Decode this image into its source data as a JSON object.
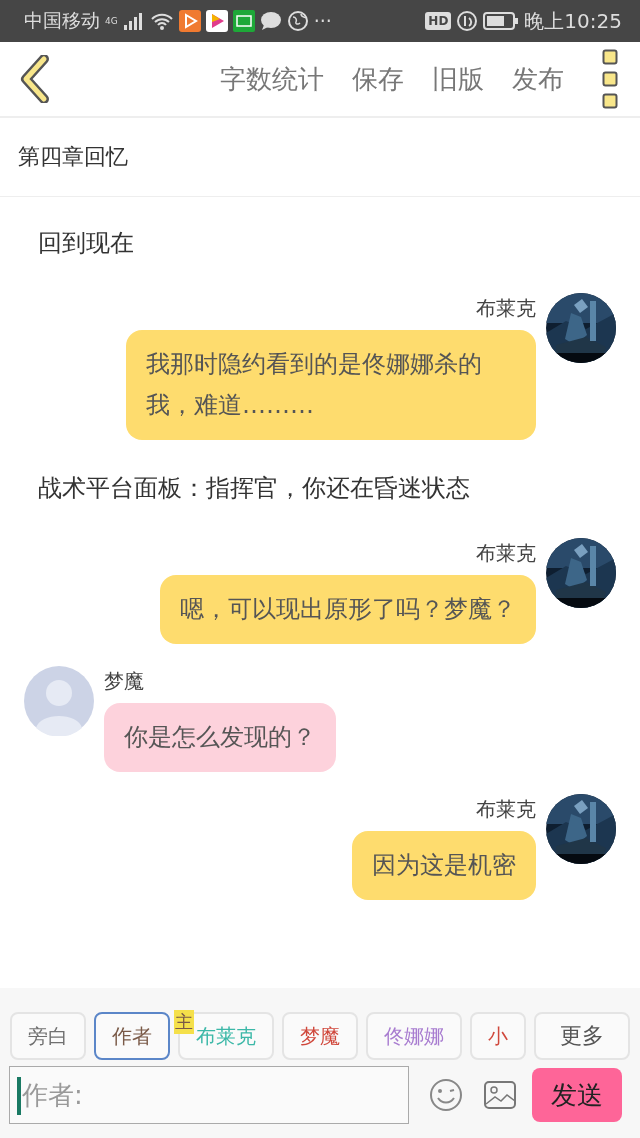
{
  "status_bar": {
    "carrier": "中国移动",
    "network": "4G",
    "more": "···",
    "hd": "HD",
    "time": "晚上10:25"
  },
  "toolbar": {
    "actions": [
      "字数统计",
      "保存",
      "旧版",
      "发布"
    ]
  },
  "chapter_title": "第四章回忆",
  "messages": [
    {
      "kind": "narration",
      "text": "回到现在"
    },
    {
      "kind": "right",
      "name": "布莱克",
      "text": "我那时隐约看到的是佟娜娜杀的我，难道………"
    },
    {
      "kind": "narration",
      "text": "战术平台面板：指挥官，你还在昏迷状态"
    },
    {
      "kind": "right",
      "name": "布莱克",
      "text": "嗯，可以现出原形了吗？梦魔？"
    },
    {
      "kind": "left",
      "name": "梦魔",
      "text": "你是怎么发现的？"
    },
    {
      "kind": "right",
      "name": "布莱克",
      "text": "因为这是机密"
    }
  ],
  "characters": [
    {
      "label": "旁白",
      "color": "#707070",
      "selected": false
    },
    {
      "label": "作者",
      "color": "#7a5a48",
      "selected": true
    },
    {
      "label": "布莱克",
      "color": "#3cb8a8",
      "selected": false,
      "badge": "主"
    },
    {
      "label": "梦魔",
      "color": "#d0483c",
      "selected": false
    },
    {
      "label": "佟娜娜",
      "color": "#a87cd0",
      "selected": false
    },
    {
      "label": "小",
      "color": "#d0483c",
      "selected": false
    }
  ],
  "more_button": "更多",
  "input": {
    "placeholder": "作者:"
  },
  "send_button": "发送"
}
